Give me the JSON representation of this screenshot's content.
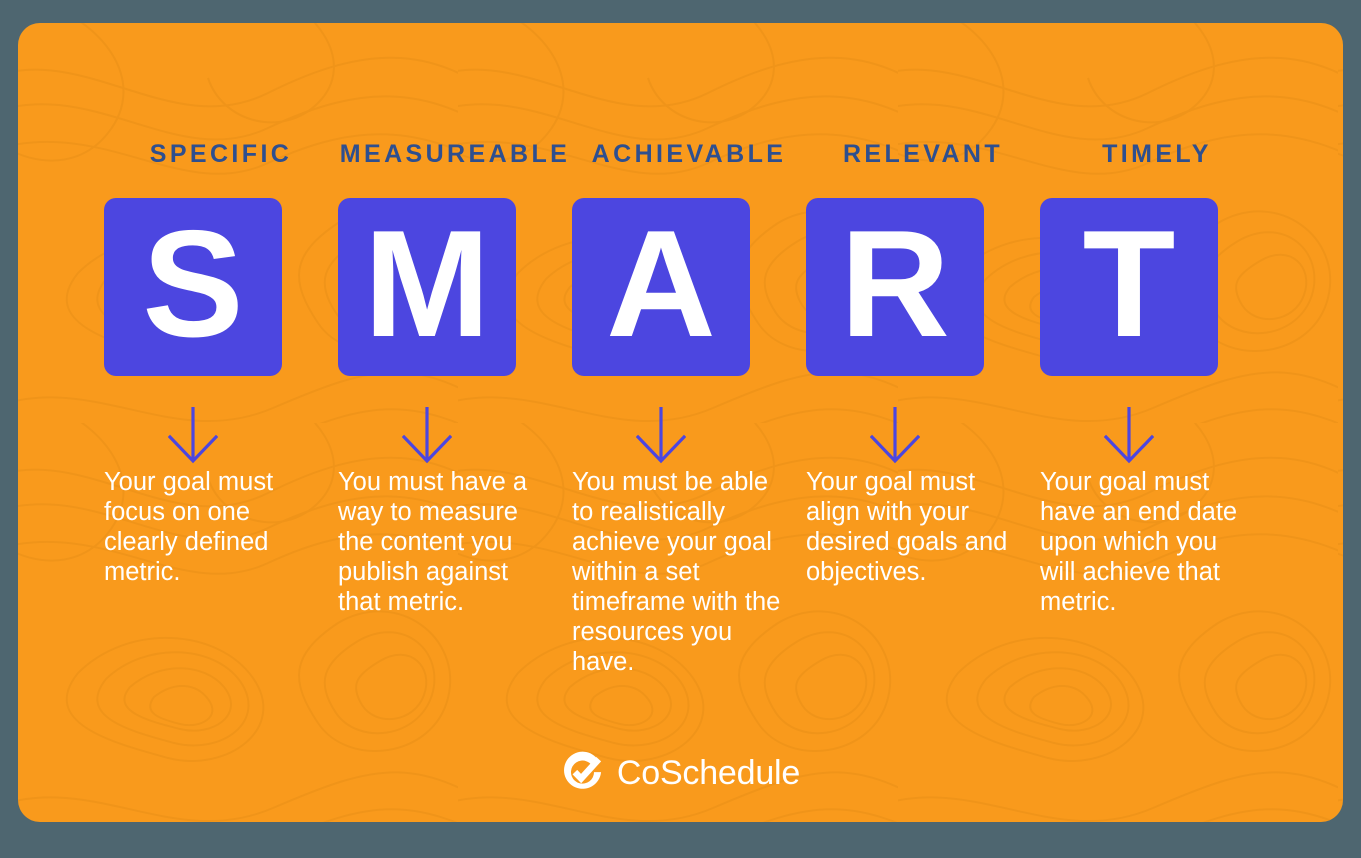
{
  "colors": {
    "page_background": "#4e6670",
    "card_background": "#f99a1c",
    "tile": "#4c46e0",
    "heading_text": "#2e4f8f",
    "body_text": "#ffffff",
    "arrow": "#4c46e0"
  },
  "columns": [
    {
      "heading": "SPECIFIC",
      "letter": "S",
      "arrow_icon": "arrow-down-icon",
      "body": "Your goal must focus on one clearly defined metric."
    },
    {
      "heading": "MEASUREABLE",
      "letter": "M",
      "arrow_icon": "arrow-down-icon",
      "body": "You must have a way to measure the content you publish against that metric."
    },
    {
      "heading": "ACHIEVABLE",
      "letter": "A",
      "arrow_icon": "arrow-down-icon",
      "body": "You must be able to realistically achieve your goal within a set timeframe with the resources you have."
    },
    {
      "heading": "RELEVANT",
      "letter": "R",
      "arrow_icon": "arrow-down-icon",
      "body": "Your goal must align with your desired goals and objectives."
    },
    {
      "heading": "TIMELY",
      "letter": "T",
      "arrow_icon": "arrow-down-icon",
      "body": "Your goal must have an end date upon which you will achieve that metric."
    }
  ],
  "logo": {
    "mark_icon": "coschedule-check-circle-icon",
    "text": "CoSchedule"
  }
}
